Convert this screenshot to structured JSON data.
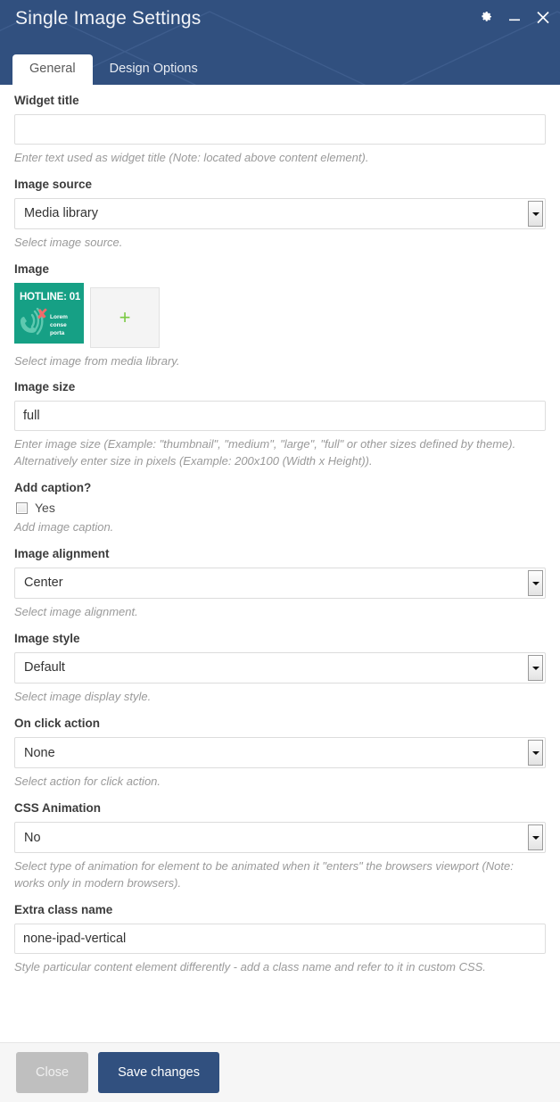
{
  "window": {
    "title": "Single Image Settings",
    "controls": [
      {
        "name": "settings-gear",
        "label": "⚙"
      },
      {
        "name": "minimize",
        "label": "–"
      },
      {
        "name": "close",
        "label": "✕"
      }
    ]
  },
  "tabs": [
    {
      "label": "General",
      "active": true
    },
    {
      "label": "Design Options",
      "active": false
    }
  ],
  "fields": {
    "widget_title": {
      "label": "Widget title",
      "value": "",
      "placeholder": "",
      "desc": "Enter text used as widget title (Note: located above content element)."
    },
    "image_source": {
      "label": "Image source",
      "value": "Media library",
      "desc": "Select image source."
    },
    "image": {
      "label": "Image",
      "desc": "Select image from media library.",
      "thumbnail": {
        "hotline": "HOTLINE: 01",
        "lorem": [
          "Lorem",
          "conse",
          "porta"
        ],
        "bg_color": "#16a085",
        "x_color": "#f06b6b"
      },
      "add_label": "+"
    },
    "image_size": {
      "label": "Image size",
      "value": "full",
      "desc": "Enter image size (Example: \"thumbnail\", \"medium\", \"large\", \"full\" or other sizes defined by theme). Alternatively enter size in pixels (Example: 200x100 (Width x Height))."
    },
    "add_caption": {
      "label": "Add caption?",
      "checkbox_label": "Yes",
      "checked": false,
      "desc": "Add image caption."
    },
    "image_alignment": {
      "label": "Image alignment",
      "value": "Center",
      "desc": "Select image alignment."
    },
    "image_style": {
      "label": "Image style",
      "value": "Default",
      "desc": "Select image display style."
    },
    "on_click_action": {
      "label": "On click action",
      "value": "None",
      "desc": "Select action for click action."
    },
    "css_animation": {
      "label": "CSS Animation",
      "value": "No",
      "desc": "Select type of animation for element to be animated when it \"enters\" the browsers viewport (Note: works only in modern browsers)."
    },
    "extra_class_name": {
      "label": "Extra class name",
      "value": "none-ipad-vertical",
      "placeholder": "",
      "desc": "Style particular content element differently - add a class name and refer to it in custom CSS."
    }
  },
  "footer": {
    "close_label": "Close",
    "save_label": "Save changes"
  },
  "colors": {
    "header_blue": "#31507f",
    "primary_button": "#31507f",
    "close_button": "#bfbfbf",
    "thumb_teal": "#16a085",
    "plus_green": "#7ac943"
  }
}
